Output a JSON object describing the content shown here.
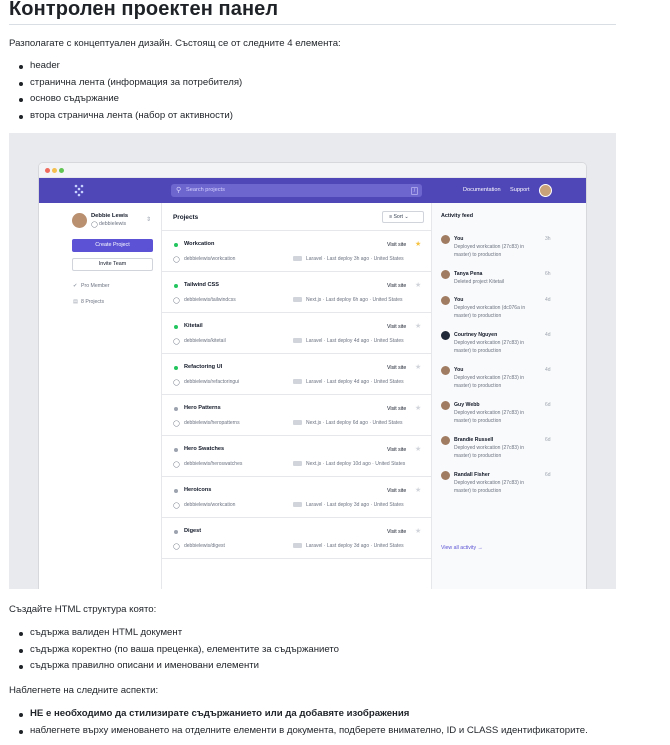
{
  "title": "Контролен проектен панел",
  "intro": "Разполагате с концептуален дизайн. Състоящ се от следните 4 елемента:",
  "elements": [
    "header",
    "странична лента (информация за потребителя)",
    "осново съдържание",
    "втора странична лента (набор от активности)"
  ],
  "task_intro": "Създайте HTML структура която:",
  "task_items": [
    "съдържа валиден HTML документ",
    "съдържа коректно (по ваша преценка), елементите за съдържанието",
    "съдържа правилно описани и именовани елементи"
  ],
  "focus_intro": "Наблегнете на следните аспекти:",
  "focus_items": [
    {
      "parts": [
        {
          "text": "НЕ е необходимо да стилизирате съдържанието или да добавяте изображения",
          "bold": true
        }
      ]
    },
    {
      "parts": [
        {
          "text": "наблегнете върху именоването на отделните елементи в документа, подберете внимателно, ID и CLASS идентификаторите.",
          "bold": false
        }
      ]
    }
  ],
  "mockup": {
    "header": {
      "search_placeholder": "Search projects",
      "search_key": "/",
      "documentation": "Documentation",
      "support": "Support"
    },
    "user": {
      "name": "Debbie Lewis",
      "handle": "debbielewis",
      "create_project": "Create Project",
      "invite_team": "Invite Team",
      "pro_member": "Pro Member",
      "projects_count": "8 Projects"
    },
    "projects_title": "Projects",
    "sort_label": "Sort",
    "projects": [
      {
        "name": "Workcation",
        "repo": "debbielewis/workcation",
        "framework": "Laravel",
        "deploy": "Last deploy 3h ago",
        "region": "United States",
        "visit": "Visit site",
        "starred": true,
        "active": true
      },
      {
        "name": "Tailwind CSS",
        "repo": "debbielewis/tailwindcss",
        "framework": "Next.js",
        "deploy": "Last deploy 6h ago",
        "region": "United States",
        "visit": "Visit site",
        "starred": false,
        "active": true
      },
      {
        "name": "Kitetail",
        "repo": "debbielewis/kitetail",
        "framework": "Laravel",
        "deploy": "Last deploy 4d ago",
        "region": "United States",
        "visit": "Visit site",
        "starred": false,
        "active": true
      },
      {
        "name": "Refactoring UI",
        "repo": "debbielewis/refactoringui",
        "framework": "Laravel",
        "deploy": "Last deploy 4d ago",
        "region": "United States",
        "visit": "Visit site",
        "starred": false,
        "active": true
      },
      {
        "name": "Hero Patterns",
        "repo": "debbielewis/heropatterns",
        "framework": "Next.js",
        "deploy": "Last deploy 6d ago",
        "region": "United States",
        "visit": "Visit site",
        "starred": false,
        "active": false
      },
      {
        "name": "Hero Swatches",
        "repo": "debbielewis/heroswatches",
        "framework": "Next.js",
        "deploy": "Last deploy 10d ago",
        "region": "United States",
        "visit": "Visit site",
        "starred": false,
        "active": false
      },
      {
        "name": "Heroicons",
        "repo": "debbielewis/workcation",
        "framework": "Laravel",
        "deploy": "Last deploy 3d ago",
        "region": "United States",
        "visit": "Visit site",
        "starred": false,
        "active": false
      },
      {
        "name": "Digest",
        "repo": "debbielewis/digest",
        "framework": "Laravel",
        "deploy": "Last deploy 3d ago",
        "region": "United States",
        "visit": "Visit site",
        "starred": false,
        "active": false
      }
    ],
    "feed_title": "Activity feed",
    "feed": [
      {
        "name": "You",
        "time": "3h",
        "text": "Deployed workcation (27c83) in master) to production"
      },
      {
        "name": "Tanya Pena",
        "time": "6h",
        "text": "Deleted project Kitetail"
      },
      {
        "name": "You",
        "time": "4d",
        "text": "Deployed workcation (dc076a in master) to production"
      },
      {
        "name": "Courtney Nguyen",
        "time": "4d",
        "text": "Deployed workcation (27c83) in master) to production"
      },
      {
        "name": "You",
        "time": "4d",
        "text": "Deployed workcation (27c83) in master) to production"
      },
      {
        "name": "Guy Webb",
        "time": "6d",
        "text": "Deployed workcation (27c83) in master) to production"
      },
      {
        "name": "Brandie Russell",
        "time": "6d",
        "text": "Deployed workcation (27c83) in master) to production"
      },
      {
        "name": "Randall Fisher",
        "time": "6d",
        "text": "Deployed workcation (27c83) in master) to production"
      }
    ],
    "view_all": "View all activity →"
  },
  "colors": {
    "brand": "#4f46b8",
    "primary_button": "#5b52d6",
    "active_dot": "#22c55e",
    "inactive_dot": "#9ca3af",
    "star_on": "#f6c342",
    "star_off": "#d1d5db"
  }
}
